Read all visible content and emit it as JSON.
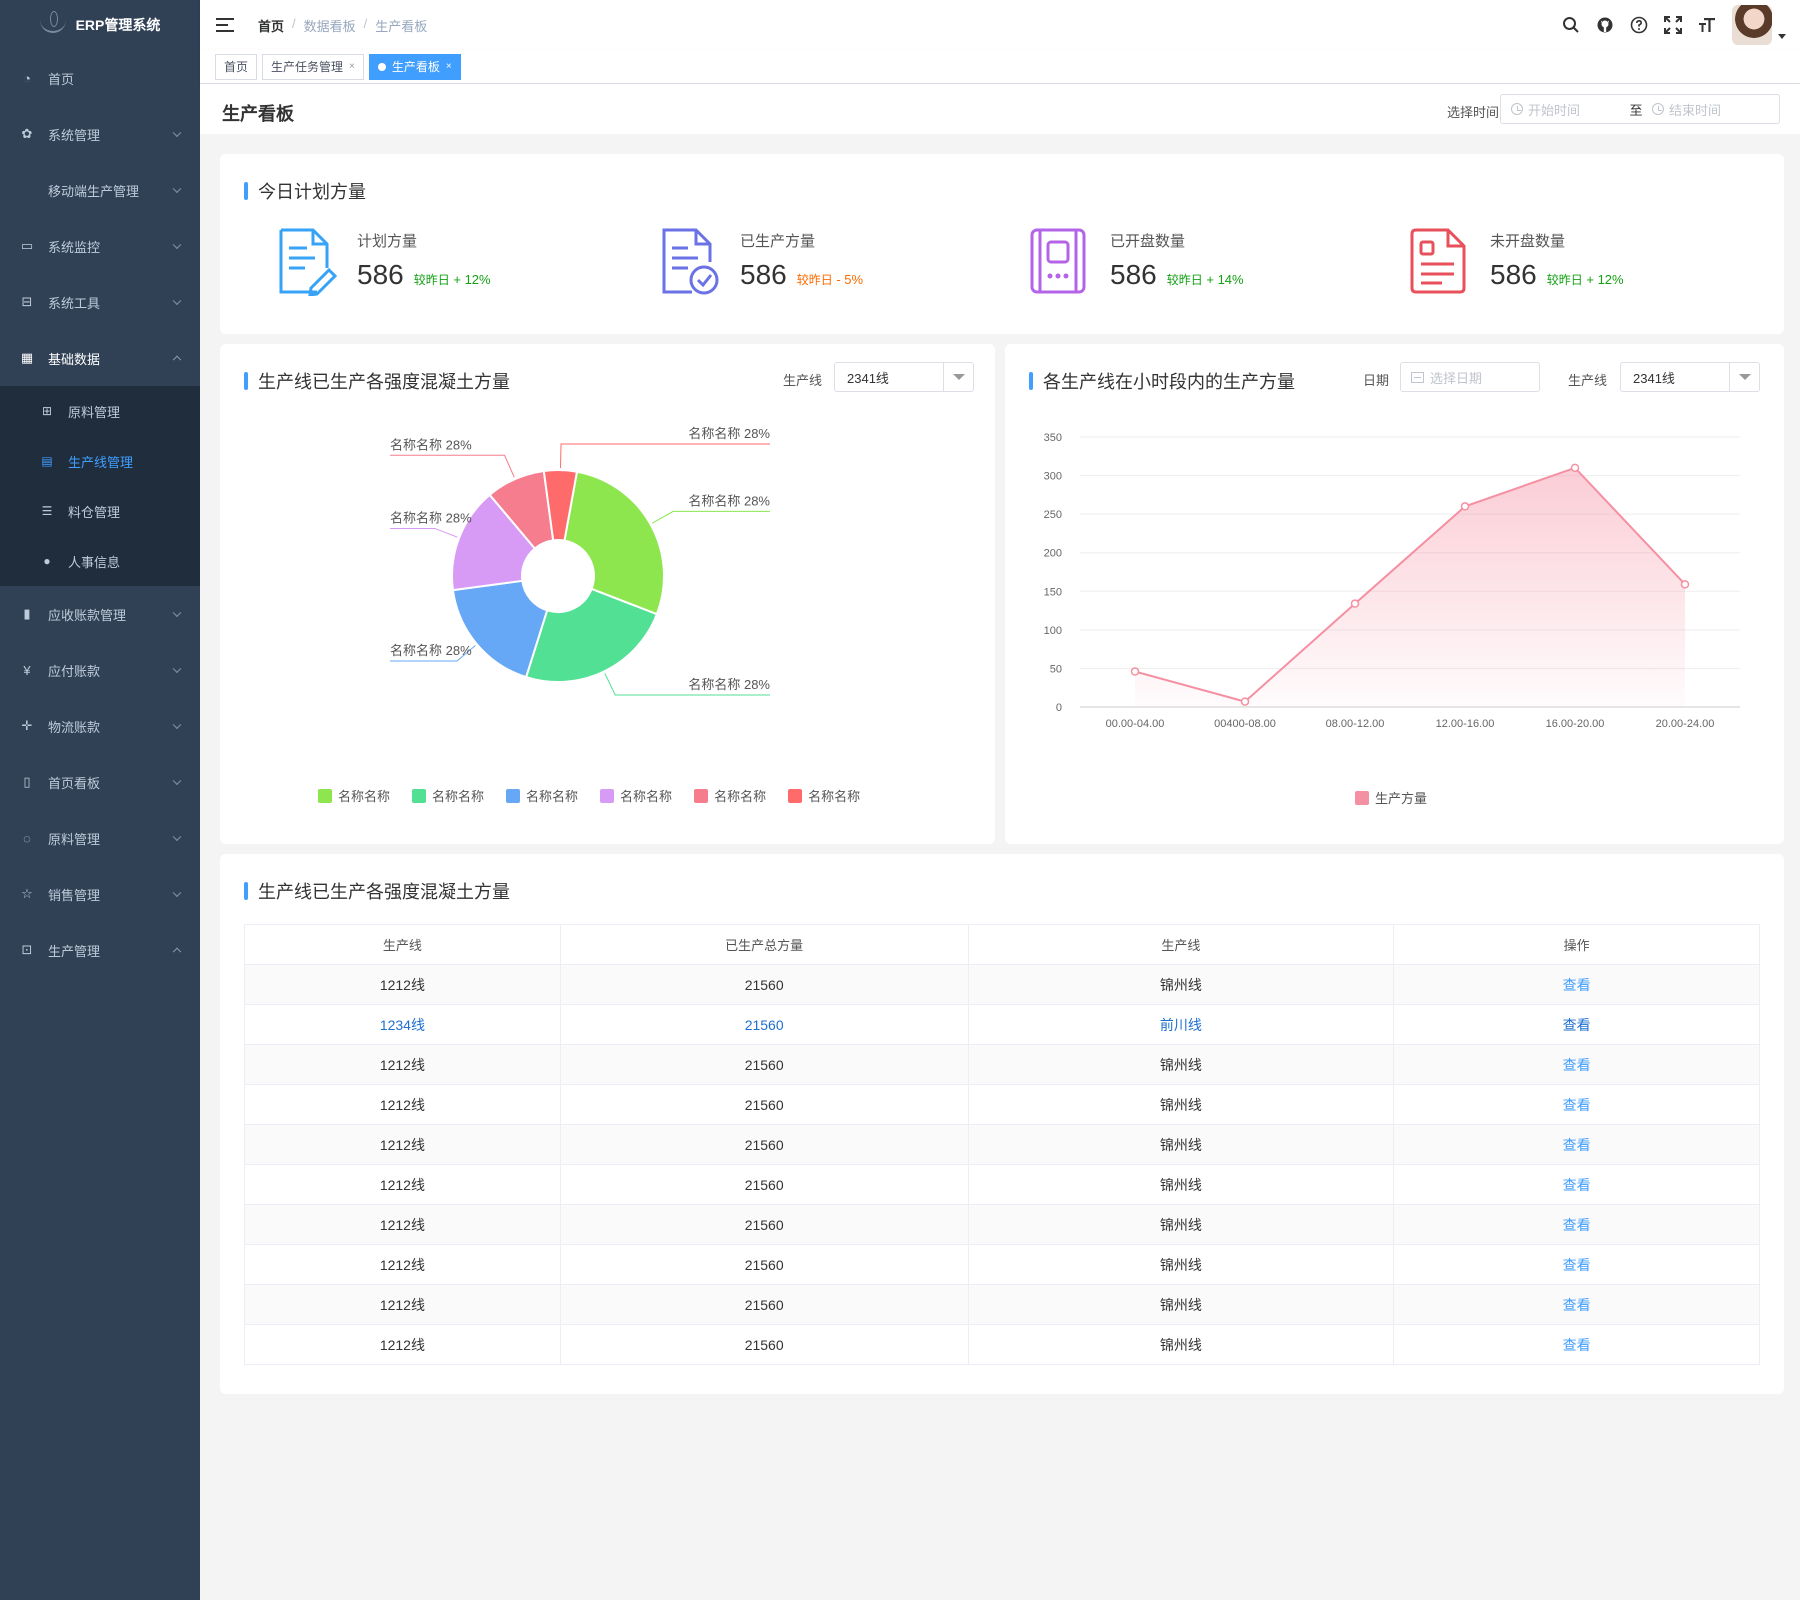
{
  "app": {
    "title": "ERP管理系统"
  },
  "sidebar": {
    "items": [
      {
        "label": "首页",
        "icon": "dashboard-icon",
        "glyph": "◔"
      },
      {
        "label": "系统管理",
        "icon": "gear-icon",
        "glyph": "✿"
      },
      {
        "label": "移动端生产管理",
        "icon": "",
        "glyph": ""
      },
      {
        "label": "系统监控",
        "icon": "monitor-icon",
        "glyph": "▭"
      },
      {
        "label": "系统工具",
        "icon": "toolbox-icon",
        "glyph": "⊟"
      },
      {
        "label": "基础数据",
        "icon": "grid-icon",
        "glyph": "▦"
      }
    ],
    "sub_items": [
      {
        "label": "原料管理",
        "icon": "table-icon",
        "glyph": "⊞"
      },
      {
        "label": "生产线管理",
        "icon": "list-icon",
        "glyph": "▤"
      },
      {
        "label": "料仓管理",
        "icon": "sliders-icon",
        "glyph": "☰"
      },
      {
        "label": "人事信息",
        "icon": "user-icon",
        "glyph": "●"
      }
    ],
    "items_after": [
      {
        "label": "应收账款管理",
        "icon": "book-icon",
        "glyph": "▮"
      },
      {
        "label": "应付账款",
        "icon": "yen-icon",
        "glyph": "¥"
      },
      {
        "label": "物流账款",
        "icon": "move-icon",
        "glyph": "✛"
      },
      {
        "label": "首页看板",
        "icon": "board-icon",
        "glyph": "▯"
      },
      {
        "label": "原料管理",
        "icon": "cycle-icon",
        "glyph": "◌"
      },
      {
        "label": "销售管理",
        "icon": "star-icon",
        "glyph": "☆"
      },
      {
        "label": "生产管理",
        "icon": "factory-icon",
        "glyph": "⊡"
      }
    ]
  },
  "breadcrumb": {
    "home": "首页",
    "sep": "/",
    "level1": "数据看板",
    "level2": "生产看板"
  },
  "tags": [
    {
      "label": "首页",
      "active": false,
      "closable": false
    },
    {
      "label": "生产任务管理",
      "active": false,
      "closable": true
    },
    {
      "label": "生产看板",
      "active": true,
      "closable": true
    }
  ],
  "tag_close": "×",
  "page": {
    "title": "生产看板",
    "range_label": "选择时间",
    "start_placeholder": "开始时间",
    "range_separator": "至",
    "end_placeholder": "结束时间"
  },
  "today": {
    "title": "今日计划方量",
    "stats": [
      {
        "label": "计划方量",
        "value": "586",
        "compare_prefix": "较昨日",
        "compare": "+ 12%",
        "trend": "up",
        "icon": "planned-document-icon",
        "color": "#36a3f7"
      },
      {
        "label": "已生产方量",
        "value": "586",
        "compare_prefix": "较昨日",
        "compare": "- 5%",
        "trend": "down",
        "icon": "produced-document-icon",
        "color": "#6a72e6"
      },
      {
        "label": "已开盘数量",
        "value": "586",
        "compare_prefix": "较昨日",
        "compare": "+ 14%",
        "trend": "up",
        "icon": "opened-device-icon",
        "color": "#b364e8"
      },
      {
        "label": "未开盘数量",
        "value": "586",
        "compare_prefix": "较昨日",
        "compare": "+ 12%",
        "trend": "up",
        "icon": "unopened-document-icon",
        "color": "#e8505b"
      }
    ],
    "trend_colors": {
      "up": "#13a113",
      "down": "#ff6a00"
    }
  },
  "pie_panel": {
    "title": "生产线已生产各强度混凝土方量",
    "line_label": "生产线",
    "line_value": "2341线"
  },
  "line_panel": {
    "title": "各生产线在小时段内的生产方量",
    "date_label": "日期",
    "date_placeholder": "选择日期",
    "line_label": "生产线",
    "line_value": "2341线"
  },
  "chart_data": [
    {
      "type": "pie",
      "variant": "donut",
      "legend_position": "bottom",
      "slices": [
        {
          "name": "名称名称",
          "value": 28,
          "label": "名称名称 28%",
          "color": "#8ee64e"
        },
        {
          "name": "名称名称",
          "value": 24,
          "label": "名称名称 28%",
          "color": "#52e094"
        },
        {
          "name": "名称名称",
          "value": 18,
          "label": "名称名称 28%",
          "color": "#66a8f5"
        },
        {
          "name": "名称名称",
          "value": 16,
          "label": "名称名称 28%",
          "color": "#d79af5"
        },
        {
          "name": "名称名称",
          "value": 9,
          "label": "名称名称 28%",
          "color": "#f57d8e"
        },
        {
          "name": "名称名称",
          "value": 5,
          "label": "名称名称 28%",
          "color": "#ff6b6b"
        }
      ]
    },
    {
      "type": "area",
      "categories": [
        "00.00-04.00",
        "00400-08.00",
        "08.00-12.00",
        "12.00-16.00",
        "16.00-20.00",
        "20.00-24.00"
      ],
      "series": [
        {
          "name": "生产方量",
          "values": [
            46,
            7,
            134,
            260,
            310,
            159
          ],
          "color": "#f58fa2"
        }
      ],
      "ylim": [
        0,
        350
      ],
      "yticks": [
        0,
        50,
        100,
        150,
        200,
        250,
        300,
        350
      ],
      "grid": true,
      "legend_position": "bottom"
    }
  ],
  "table": {
    "title": "生产线已生产各强度混凝土方量",
    "headers": [
      "生产线",
      "已生产总方量",
      "生产线",
      "操作"
    ],
    "action_label": "查看",
    "rows": [
      [
        "1212线",
        "21560",
        "锦州线"
      ],
      [
        "1234线",
        "21560",
        "前川线"
      ],
      [
        "1212线",
        "21560",
        "锦州线"
      ],
      [
        "1212线",
        "21560",
        "锦州线"
      ],
      [
        "1212线",
        "21560",
        "锦州线"
      ],
      [
        "1212线",
        "21560",
        "锦州线"
      ],
      [
        "1212线",
        "21560",
        "锦州线"
      ],
      [
        "1212线",
        "21560",
        "锦州线"
      ],
      [
        "1212线",
        "21560",
        "锦州线"
      ],
      [
        "1212线",
        "21560",
        "锦州线"
      ]
    ]
  }
}
